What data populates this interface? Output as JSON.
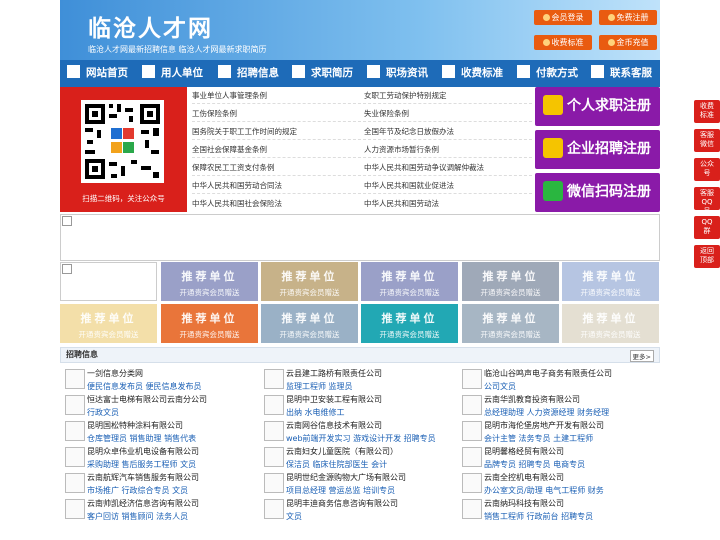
{
  "header": {
    "site_title": "临沧人才网",
    "slogan": "临沧人才网最新招聘信息  临沧人才网最新求职简历",
    "buttons": [
      {
        "label": "会员登录",
        "icon": "user-icon"
      },
      {
        "label": "免费注册",
        "icon": "register-icon"
      },
      {
        "label": "收费标准",
        "icon": "yen-icon"
      },
      {
        "label": "金币充值",
        "icon": "coin-icon"
      }
    ]
  },
  "nav": {
    "items": [
      {
        "label": "网站首页",
        "icon": "home-icon"
      },
      {
        "label": "用人单位",
        "icon": "building-icon"
      },
      {
        "label": "招聘信息",
        "icon": "megaphone-icon"
      },
      {
        "label": "求职简历",
        "icon": "resume-icon"
      },
      {
        "label": "职场资讯",
        "icon": "news-icon"
      },
      {
        "label": "收费标准",
        "icon": "pricing-icon"
      },
      {
        "label": "付款方式",
        "icon": "payment-icon"
      },
      {
        "label": "联系客服",
        "icon": "phone-icon"
      }
    ]
  },
  "qr": {
    "caption": "扫描二维码，关注公众号"
  },
  "links": {
    "left": [
      "事业单位人事管理条例",
      "工伤保险条例",
      "国务院关于职工工作时间的规定",
      "全国社会保障基金条例",
      "保障农民工工资支付条例",
      "中华人民共和国劳动合同法",
      "中华人民共和国社会保险法"
    ],
    "right": [
      "女职工劳动保护特别规定",
      "失业保险条例",
      "全国年节及纪念日放假办法",
      "人力资源市场暂行条例",
      "中华人民共和国劳动争议调解仲裁法",
      "中华人民共和国就业促进法",
      "中华人民共和国劳动法"
    ]
  },
  "register": [
    {
      "label": "个人求职注册",
      "icon": "person-icon"
    },
    {
      "label": "企业招聘注册",
      "icon": "company-icon"
    },
    {
      "label": "微信扫码注册",
      "icon": "wechat-icon"
    }
  ],
  "recommend": {
    "title": "推荐单位",
    "subtitle": "开通贵宾会员赠送",
    "colors": [
      "#9aa0c8",
      "#c7b289",
      "#9aa0c8",
      "#9fa9b8",
      "#b6c5e2",
      "#f3dfa9",
      "#e9753a",
      "#9ab1c6",
      "#22a8b4",
      "#a7b6c4",
      "#e4dfd2",
      "#ba8a26"
    ]
  },
  "jobs_section": {
    "title": "招聘信息",
    "more_label": "更多>",
    "columns": [
      [
        {
          "company": "一剑信息分类网",
          "positions": "便民信息发布员  便民信息发布员"
        },
        {
          "company": "恒达富士电梯有限公司云南分公司",
          "positions": "行政文员"
        },
        {
          "company": "昆明国松特种涂料有限公司",
          "positions": "仓库管理员  销售助理  销售代表"
        },
        {
          "company": "昆明众卓伟业机电设备有限公司",
          "positions": "采购助理  售后服务工程师  文员"
        },
        {
          "company": "云南航辉汽车销售服务有限公司",
          "positions": "市场推广  行政综合专员  文员"
        },
        {
          "company": "云南帅凯经济信息咨询有限公司",
          "positions": "客户回访  销售顾问  法务人员"
        }
      ],
      [
        {
          "company": "云县建工路桥有限责任公司",
          "positions": "监理工程师  监理员"
        },
        {
          "company": "昆明中卫安装工程有限公司",
          "positions": "出纳  水电维修工"
        },
        {
          "company": "云南网谷信息技术有限公司",
          "positions": "web前端开发实习  游戏设计开发  招聘专员"
        },
        {
          "company": "云南妇女儿童医院（有限公司）",
          "positions": "保洁员  临床住院部医生  会计"
        },
        {
          "company": "昆明世纪金源购物大广场有限公司",
          "positions": "项目总经理  营运总监  培训专员"
        },
        {
          "company": "昆明丰迪商务信息咨询有限公司",
          "positions": "文员"
        }
      ],
      [
        {
          "company": "临沧山谷鸣声电子商务有限责任公司",
          "positions": "公司文员"
        },
        {
          "company": "云南华凯教育投资有限公司",
          "positions": "总经理助理  人力资源经理  财务经理"
        },
        {
          "company": "昆明市海伦堡房地产开发有限公司",
          "positions": "会计主管  法务专员  土建工程师"
        },
        {
          "company": "昆明馨格经贸有限公司",
          "positions": "品牌专员  招聘专员  电商专员"
        },
        {
          "company": "云南全控机电有限公司",
          "positions": "办公室文员/助理  电气工程师  财务"
        },
        {
          "company": "云南纳玛科技有限公司",
          "positions": "销售工程师  行政前台  招聘专员"
        }
      ]
    ]
  },
  "side_buttons": [
    {
      "label": "收费标准"
    },
    {
      "label": "客服微信"
    },
    {
      "label": "公众号"
    },
    {
      "label": "客服QQ号"
    },
    {
      "label": "QQ群"
    },
    {
      "label": "返回顶部"
    }
  ]
}
